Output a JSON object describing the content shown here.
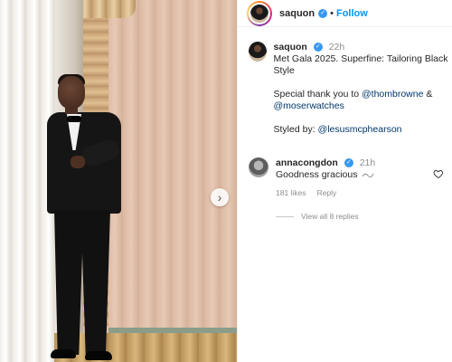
{
  "header": {
    "username": "saquon",
    "separator": "•",
    "follow_label": "Follow"
  },
  "caption": {
    "username": "saquon",
    "time": "22h",
    "line1": "Met Gala 2025. Superfine: Tailoring Black Style",
    "thanks_prefix": "Special thank you to ",
    "mention1": "@thombrowne",
    "amp": " &",
    "mention2": "@moserwatches",
    "styled_prefix": "Styled by: ",
    "stylist": "@lesusmcphearson"
  },
  "comment": {
    "username": "annacongdon",
    "time": "21h",
    "text": "Goodness gracious",
    "likes": "181 likes",
    "reply_label": "Reply"
  },
  "view_replies": "View all 8 replies",
  "icons": {
    "verified": "verified-badge-icon",
    "heart": "heart-icon",
    "next": "chevron-right-icon"
  },
  "colors": {
    "link": "#0095f6",
    "mention": "#00376b",
    "verified": "#3897f0"
  }
}
